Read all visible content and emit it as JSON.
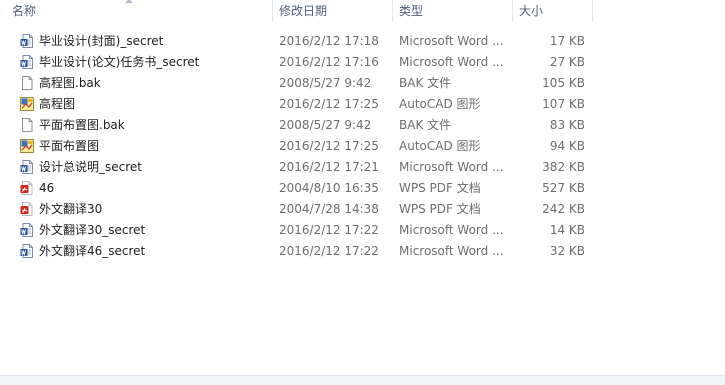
{
  "columns": {
    "name": "名称",
    "date": "修改日期",
    "type": "类型",
    "size": "大小"
  },
  "files": [
    {
      "icon": "word-doc-icon",
      "name": "毕业设计(封面)_secret",
      "date": "2016/2/12 17:18",
      "type": "Microsoft Word ...",
      "size": "17 KB"
    },
    {
      "icon": "word-doc-icon",
      "name": "毕业设计(论文)任务书_secret",
      "date": "2016/2/12 17:16",
      "type": "Microsoft Word ...",
      "size": "27 KB"
    },
    {
      "icon": "generic-file-icon",
      "name": "高程图.bak",
      "date": "2008/5/27 9:42",
      "type": "BAK 文件",
      "size": "105 KB"
    },
    {
      "icon": "autocad-drawing-icon",
      "name": "高程图",
      "date": "2016/2/12 17:25",
      "type": "AutoCAD 图形",
      "size": "107 KB"
    },
    {
      "icon": "generic-file-icon",
      "name": "平面布置图.bak",
      "date": "2008/5/27 9:42",
      "type": "BAK 文件",
      "size": "83 KB"
    },
    {
      "icon": "autocad-drawing-icon",
      "name": "平面布置图",
      "date": "2016/2/12 17:25",
      "type": "AutoCAD 图形",
      "size": "94 KB"
    },
    {
      "icon": "word-doc-icon",
      "name": "设计总说明_secret",
      "date": "2016/2/12 17:21",
      "type": "Microsoft Word ...",
      "size": "382 KB"
    },
    {
      "icon": "pdf-file-icon",
      "name": "46",
      "date": "2004/8/10 16:35",
      "type": "WPS PDF 文档",
      "size": "527 KB"
    },
    {
      "icon": "pdf-file-icon",
      "name": "外文翻译30",
      "date": "2004/7/28 14:38",
      "type": "WPS PDF 文档",
      "size": "242 KB"
    },
    {
      "icon": "word-doc-icon",
      "name": "外文翻译30_secret",
      "date": "2016/2/12 17:22",
      "type": "Microsoft Word ...",
      "size": "14 KB"
    },
    {
      "icon": "word-doc-icon",
      "name": "外文翻译46_secret",
      "date": "2016/2/12 17:22",
      "type": "Microsoft Word ...",
      "size": "32 KB"
    }
  ]
}
